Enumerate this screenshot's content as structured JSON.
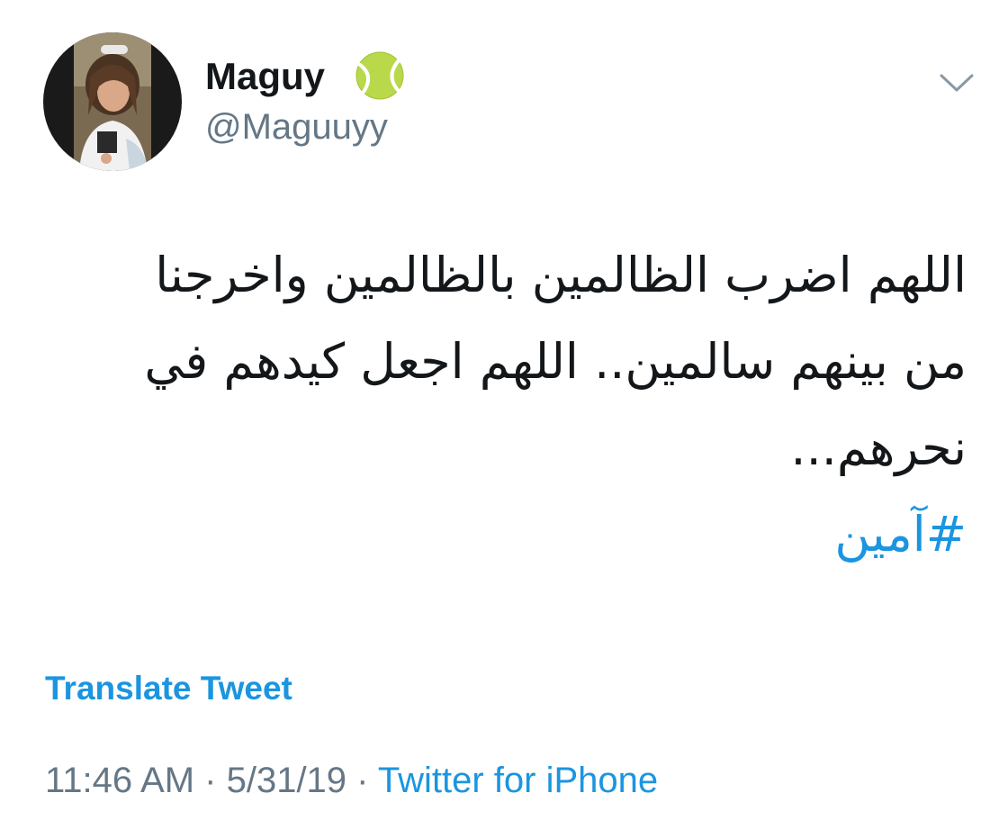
{
  "colors": {
    "text": "#14171a",
    "secondary": "#657786",
    "link": "#1b95e0",
    "background": "#ffffff"
  },
  "author": {
    "display_name": "Maguy",
    "handle": "@Maguuyy",
    "name_emoji": "tennis-ball-icon"
  },
  "tweet": {
    "lines": [
      "اللهم اضرب الظالمين بالظالمين واخرجنا",
      "من بينهم سالمين.. اللهم اجعل كيدهم في",
      "نحرهم..."
    ],
    "hashtag": "#آمين",
    "translate_label": "Translate Tweet"
  },
  "meta": {
    "time": "11:46 AM",
    "separator": " · ",
    "date": "5/31/19",
    "source": "Twitter for iPhone"
  },
  "icons": {
    "more_menu": "chevron-down-icon"
  }
}
